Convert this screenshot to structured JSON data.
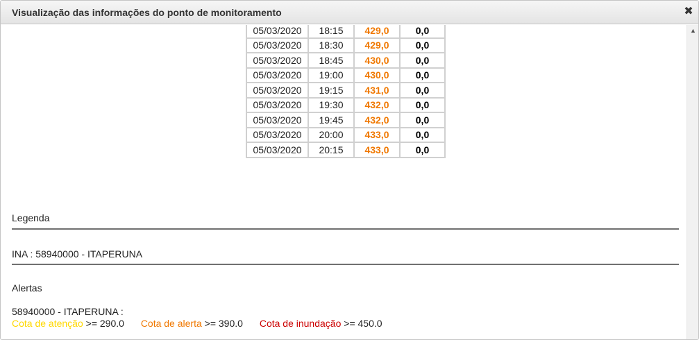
{
  "window": {
    "title": "Visualização das informações do ponto de monitoramento",
    "close_icon": "close-x-icon"
  },
  "colors": {
    "cota_value": "#f07800",
    "atencao": "#ffd800",
    "alerta": "#f07800",
    "inundacao": "#cc0000"
  },
  "readings": [
    {
      "date": "05/03/2020",
      "time": "18:15",
      "cota": "429,0",
      "chuva": "0,0"
    },
    {
      "date": "05/03/2020",
      "time": "18:30",
      "cota": "429,0",
      "chuva": "0,0"
    },
    {
      "date": "05/03/2020",
      "time": "18:45",
      "cota": "430,0",
      "chuva": "0,0"
    },
    {
      "date": "05/03/2020",
      "time": "19:00",
      "cota": "430,0",
      "chuva": "0,0"
    },
    {
      "date": "05/03/2020",
      "time": "19:15",
      "cota": "431,0",
      "chuva": "0,0"
    },
    {
      "date": "05/03/2020",
      "time": "19:30",
      "cota": "432,0",
      "chuva": "0,0"
    },
    {
      "date": "05/03/2020",
      "time": "19:45",
      "cota": "432,0",
      "chuva": "0,0"
    },
    {
      "date": "05/03/2020",
      "time": "20:00",
      "cota": "433,0",
      "chuva": "0,0"
    },
    {
      "date": "05/03/2020",
      "time": "20:15",
      "cota": "433,0",
      "chuva": "0,0"
    }
  ],
  "legend": {
    "heading": "Legenda",
    "ina": "INA : 58940000 - ITAPERUNA"
  },
  "alerts": {
    "heading": "Alertas",
    "station": "58940000 - ITAPERUNA :",
    "atencao_label": "Cota de atenção",
    "atencao_value": ">= 290.0",
    "alerta_label": "Cota de alerta",
    "alerta_value": ">= 390.0",
    "inundacao_label": "Cota de inundação",
    "inundacao_value": ">= 450.0"
  }
}
